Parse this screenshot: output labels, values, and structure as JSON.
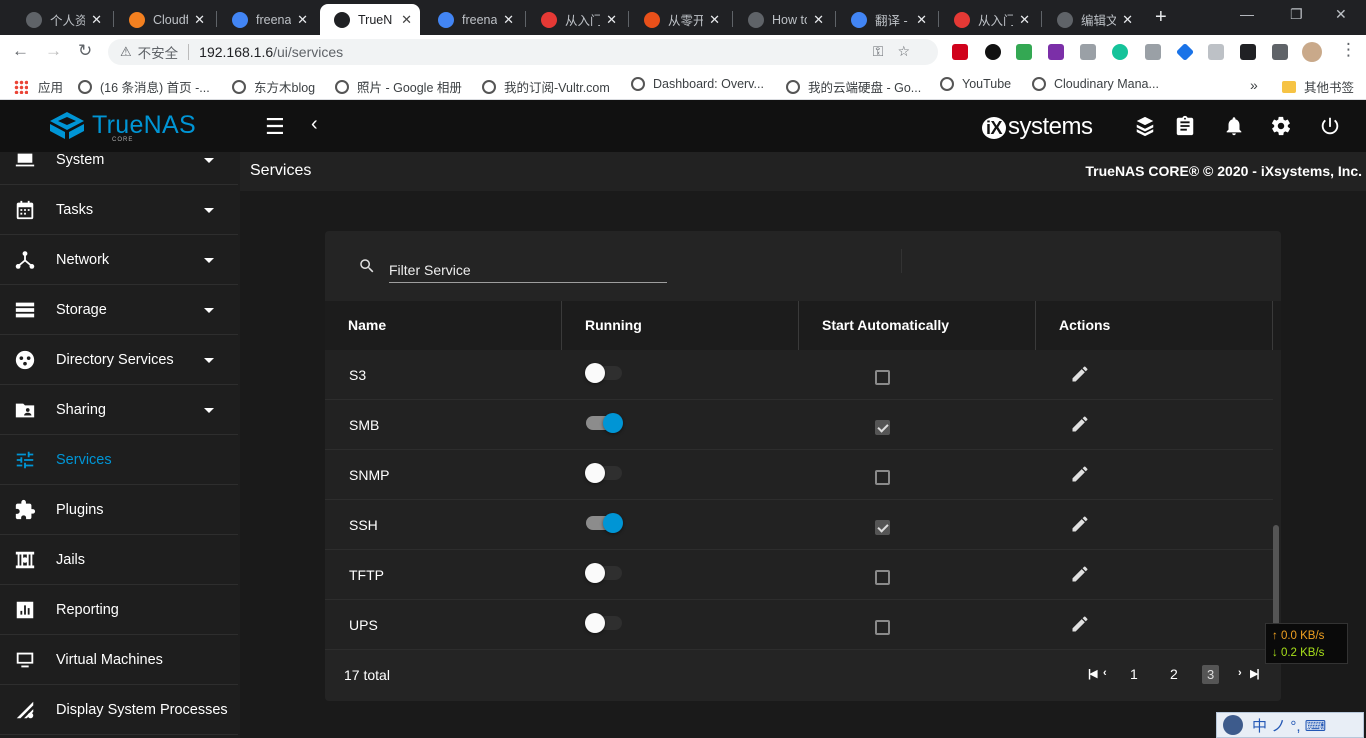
{
  "browser": {
    "tabs": [
      {
        "title": "个人资",
        "icon_color": "#5f6368",
        "icon": "globe-icon",
        "active": false
      },
      {
        "title": "Cloudf",
        "icon_color": "#f38020",
        "icon": "cloudflare-icon",
        "active": false
      },
      {
        "title": "freena",
        "icon_color": "#4285f4",
        "icon": "google-icon",
        "active": false
      },
      {
        "title": "TrueN",
        "icon_color": "#202124",
        "icon": "truenas-icon",
        "active": true
      },
      {
        "title": "freena",
        "icon_color": "#4285f4",
        "icon": "google-icon",
        "active": false
      },
      {
        "title": "从入门",
        "icon_color": "#e53935",
        "icon": "smzdm-icon",
        "active": false
      },
      {
        "title": "从零开",
        "icon_color": "#e8501a",
        "icon": "csdn-icon",
        "active": false
      },
      {
        "title": "How to",
        "icon_color": "#5f6368",
        "icon": "globe-icon",
        "active": false
      },
      {
        "title": "翻译 -",
        "icon_color": "#4285f4",
        "icon": "google-icon",
        "active": false
      },
      {
        "title": "从入门",
        "icon_color": "#e53935",
        "icon": "smzdm-icon",
        "active": false
      },
      {
        "title": "编辑文",
        "icon_color": "#5f6368",
        "icon": "globe-icon",
        "active": false
      }
    ],
    "new_tab": "+",
    "security_label": "不安全",
    "url_host": "192.168.1.6",
    "url_path": "/ui/services",
    "bookmarks": [
      {
        "label": "应用",
        "icon": "apps-grid-icon"
      },
      {
        "label": "(16 条消息) 首页 -...",
        "icon": "globe-icon"
      },
      {
        "label": "东方木blog",
        "icon": "globe-icon"
      },
      {
        "label": "照片 - Google 相册",
        "icon": "globe-icon"
      },
      {
        "label": "我的订阅-Vultr.com",
        "icon": "globe-icon"
      },
      {
        "label": "Dashboard: Overv...",
        "icon": "globe-icon"
      },
      {
        "label": "我的云端硬盘 - Go...",
        "icon": "globe-icon"
      },
      {
        "label": "YouTube",
        "icon": "globe-icon"
      },
      {
        "label": "Cloudinary Mana...",
        "icon": "globe-icon"
      }
    ],
    "bookmarks_overflow": "»",
    "other_bookmarks": "其他书签"
  },
  "app": {
    "brand": "TrueNAS",
    "brand_sub": "CORE",
    "vendor": "systems",
    "vendor_prefix": "iX",
    "accent": "#0095d5"
  },
  "sidebar": {
    "items": [
      {
        "label": "System",
        "icon": "laptop-icon",
        "expandable": true,
        "active": false
      },
      {
        "label": "Tasks",
        "icon": "calendar-icon",
        "expandable": true,
        "active": false
      },
      {
        "label": "Network",
        "icon": "network-icon",
        "expandable": true,
        "active": false
      },
      {
        "label": "Storage",
        "icon": "storage-icon",
        "expandable": true,
        "active": false
      },
      {
        "label": "Directory Services",
        "icon": "directory-icon",
        "expandable": true,
        "active": false
      },
      {
        "label": "Sharing",
        "icon": "folder-share-icon",
        "expandable": true,
        "active": false
      },
      {
        "label": "Services",
        "icon": "tune-icon",
        "expandable": false,
        "active": true
      },
      {
        "label": "Plugins",
        "icon": "puzzle-icon",
        "expandable": false,
        "active": false
      },
      {
        "label": "Jails",
        "icon": "jail-icon",
        "expandable": false,
        "active": false
      },
      {
        "label": "Reporting",
        "icon": "chart-icon",
        "expandable": false,
        "active": false
      },
      {
        "label": "Virtual Machines",
        "icon": "monitor-icon",
        "expandable": false,
        "active": false
      },
      {
        "label": "Display System Processes",
        "icon": "processes-icon",
        "expandable": false,
        "active": false
      }
    ]
  },
  "page": {
    "breadcrumb": "Services",
    "copyright": "TrueNAS CORE® © 2020 - iXsystems, Inc."
  },
  "services": {
    "filter_placeholder": "Filter Service",
    "columns": [
      "Name",
      "Running",
      "Start Automatically",
      "Actions"
    ],
    "rows": [
      {
        "name": "S3",
        "running": false,
        "start_auto": false
      },
      {
        "name": "SMB",
        "running": true,
        "start_auto": true
      },
      {
        "name": "SNMP",
        "running": false,
        "start_auto": false
      },
      {
        "name": "SSH",
        "running": true,
        "start_auto": true
      },
      {
        "name": "TFTP",
        "running": false,
        "start_auto": false
      },
      {
        "name": "UPS",
        "running": false,
        "start_auto": false
      }
    ],
    "total": "17 total",
    "pages": [
      "1",
      "2",
      "3"
    ],
    "current_page": "3"
  },
  "netspeed": {
    "up": "↑ 0.0 KB/s",
    "down": "↓ 0.2 KB/s"
  },
  "ime": {
    "text": "中 ノ °, ⌨"
  }
}
